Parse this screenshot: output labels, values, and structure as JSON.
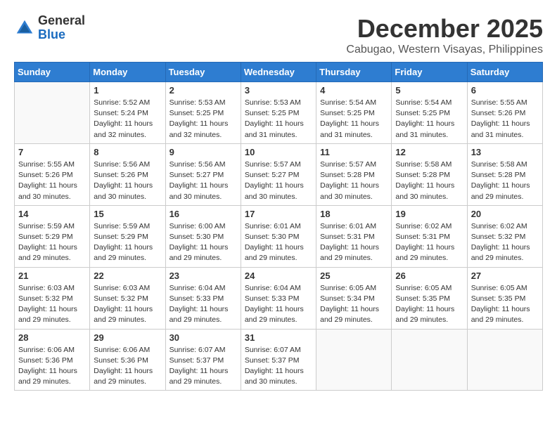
{
  "header": {
    "logo_general": "General",
    "logo_blue": "Blue",
    "month": "December 2025",
    "location": "Cabugao, Western Visayas, Philippines"
  },
  "calendar": {
    "days_of_week": [
      "Sunday",
      "Monday",
      "Tuesday",
      "Wednesday",
      "Thursday",
      "Friday",
      "Saturday"
    ],
    "weeks": [
      [
        {
          "day": "",
          "info": ""
        },
        {
          "day": "1",
          "info": "Sunrise: 5:52 AM\nSunset: 5:24 PM\nDaylight: 11 hours\nand 32 minutes."
        },
        {
          "day": "2",
          "info": "Sunrise: 5:53 AM\nSunset: 5:25 PM\nDaylight: 11 hours\nand 32 minutes."
        },
        {
          "day": "3",
          "info": "Sunrise: 5:53 AM\nSunset: 5:25 PM\nDaylight: 11 hours\nand 31 minutes."
        },
        {
          "day": "4",
          "info": "Sunrise: 5:54 AM\nSunset: 5:25 PM\nDaylight: 11 hours\nand 31 minutes."
        },
        {
          "day": "5",
          "info": "Sunrise: 5:54 AM\nSunset: 5:25 PM\nDaylight: 11 hours\nand 31 minutes."
        },
        {
          "day": "6",
          "info": "Sunrise: 5:55 AM\nSunset: 5:26 PM\nDaylight: 11 hours\nand 31 minutes."
        }
      ],
      [
        {
          "day": "7",
          "info": "Sunrise: 5:55 AM\nSunset: 5:26 PM\nDaylight: 11 hours\nand 30 minutes."
        },
        {
          "day": "8",
          "info": "Sunrise: 5:56 AM\nSunset: 5:26 PM\nDaylight: 11 hours\nand 30 minutes."
        },
        {
          "day": "9",
          "info": "Sunrise: 5:56 AM\nSunset: 5:27 PM\nDaylight: 11 hours\nand 30 minutes."
        },
        {
          "day": "10",
          "info": "Sunrise: 5:57 AM\nSunset: 5:27 PM\nDaylight: 11 hours\nand 30 minutes."
        },
        {
          "day": "11",
          "info": "Sunrise: 5:57 AM\nSunset: 5:28 PM\nDaylight: 11 hours\nand 30 minutes."
        },
        {
          "day": "12",
          "info": "Sunrise: 5:58 AM\nSunset: 5:28 PM\nDaylight: 11 hours\nand 30 minutes."
        },
        {
          "day": "13",
          "info": "Sunrise: 5:58 AM\nSunset: 5:28 PM\nDaylight: 11 hours\nand 29 minutes."
        }
      ],
      [
        {
          "day": "14",
          "info": "Sunrise: 5:59 AM\nSunset: 5:29 PM\nDaylight: 11 hours\nand 29 minutes."
        },
        {
          "day": "15",
          "info": "Sunrise: 5:59 AM\nSunset: 5:29 PM\nDaylight: 11 hours\nand 29 minutes."
        },
        {
          "day": "16",
          "info": "Sunrise: 6:00 AM\nSunset: 5:30 PM\nDaylight: 11 hours\nand 29 minutes."
        },
        {
          "day": "17",
          "info": "Sunrise: 6:01 AM\nSunset: 5:30 PM\nDaylight: 11 hours\nand 29 minutes."
        },
        {
          "day": "18",
          "info": "Sunrise: 6:01 AM\nSunset: 5:31 PM\nDaylight: 11 hours\nand 29 minutes."
        },
        {
          "day": "19",
          "info": "Sunrise: 6:02 AM\nSunset: 5:31 PM\nDaylight: 11 hours\nand 29 minutes."
        },
        {
          "day": "20",
          "info": "Sunrise: 6:02 AM\nSunset: 5:32 PM\nDaylight: 11 hours\nand 29 minutes."
        }
      ],
      [
        {
          "day": "21",
          "info": "Sunrise: 6:03 AM\nSunset: 5:32 PM\nDaylight: 11 hours\nand 29 minutes."
        },
        {
          "day": "22",
          "info": "Sunrise: 6:03 AM\nSunset: 5:32 PM\nDaylight: 11 hours\nand 29 minutes."
        },
        {
          "day": "23",
          "info": "Sunrise: 6:04 AM\nSunset: 5:33 PM\nDaylight: 11 hours\nand 29 minutes."
        },
        {
          "day": "24",
          "info": "Sunrise: 6:04 AM\nSunset: 5:33 PM\nDaylight: 11 hours\nand 29 minutes."
        },
        {
          "day": "25",
          "info": "Sunrise: 6:05 AM\nSunset: 5:34 PM\nDaylight: 11 hours\nand 29 minutes."
        },
        {
          "day": "26",
          "info": "Sunrise: 6:05 AM\nSunset: 5:35 PM\nDaylight: 11 hours\nand 29 minutes."
        },
        {
          "day": "27",
          "info": "Sunrise: 6:05 AM\nSunset: 5:35 PM\nDaylight: 11 hours\nand 29 minutes."
        }
      ],
      [
        {
          "day": "28",
          "info": "Sunrise: 6:06 AM\nSunset: 5:36 PM\nDaylight: 11 hours\nand 29 minutes."
        },
        {
          "day": "29",
          "info": "Sunrise: 6:06 AM\nSunset: 5:36 PM\nDaylight: 11 hours\nand 29 minutes."
        },
        {
          "day": "30",
          "info": "Sunrise: 6:07 AM\nSunset: 5:37 PM\nDaylight: 11 hours\nand 29 minutes."
        },
        {
          "day": "31",
          "info": "Sunrise: 6:07 AM\nSunset: 5:37 PM\nDaylight: 11 hours\nand 30 minutes."
        },
        {
          "day": "",
          "info": ""
        },
        {
          "day": "",
          "info": ""
        },
        {
          "day": "",
          "info": ""
        }
      ]
    ]
  }
}
